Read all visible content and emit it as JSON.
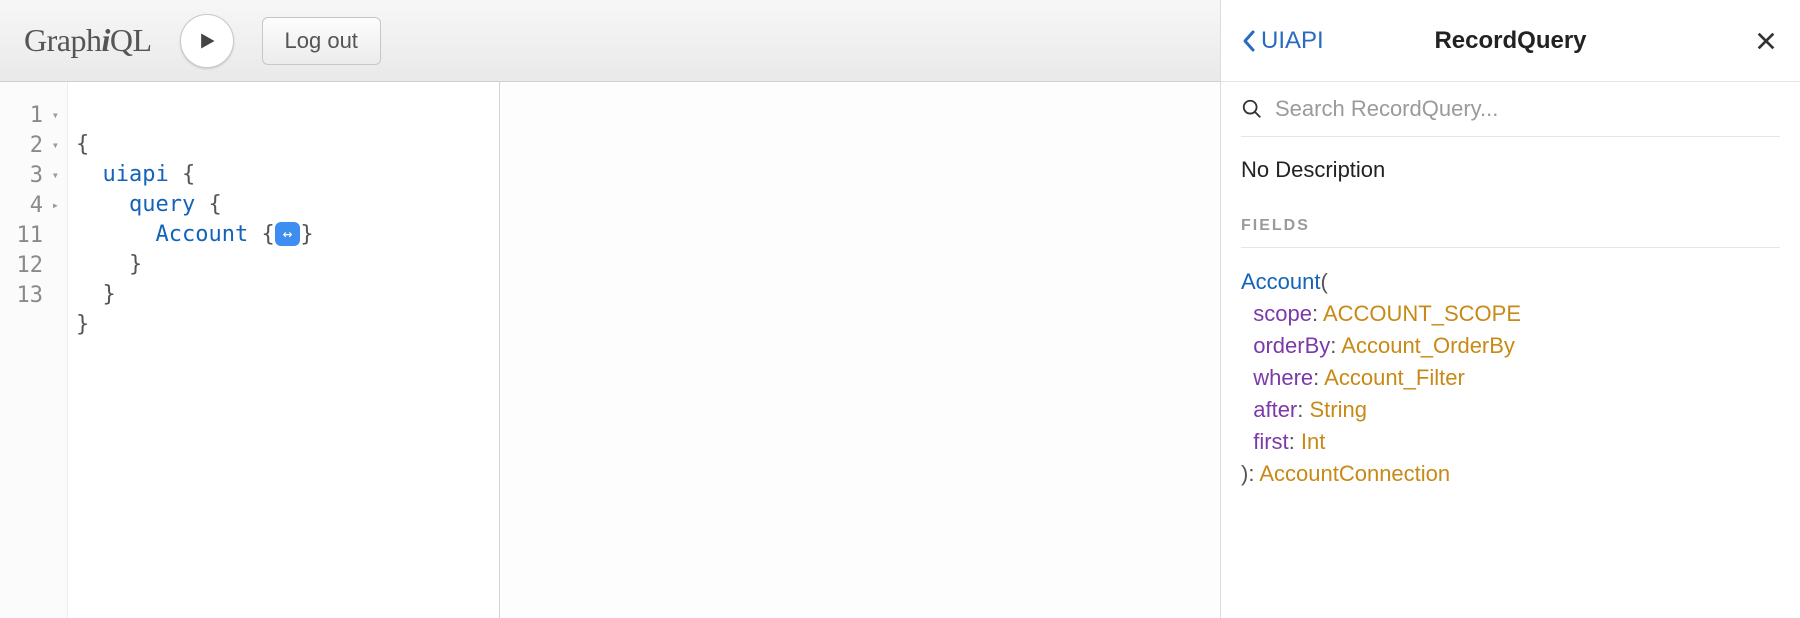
{
  "topbar": {
    "logo_prefix": "Graph",
    "logo_i": "i",
    "logo_suffix": "QL",
    "logout_label": "Log out"
  },
  "editor": {
    "lines": [
      {
        "n": "1",
        "fold": "▾"
      },
      {
        "n": "2",
        "fold": "▾"
      },
      {
        "n": "3",
        "fold": "▾"
      },
      {
        "n": "4",
        "fold": "▸"
      },
      {
        "n": "11",
        "fold": ""
      },
      {
        "n": "12",
        "fold": ""
      },
      {
        "n": "13",
        "fold": ""
      }
    ],
    "t_open": "{",
    "t_close": "}",
    "t_uiapi": "uiapi",
    "t_query": "query",
    "t_account": "Account",
    "fold_glyph": "↔"
  },
  "docs": {
    "back_label": "UIAPI",
    "title": "RecordQuery",
    "search_placeholder": "Search RecordQuery...",
    "description": "No Description",
    "section_fields": "FIELDS",
    "field": {
      "name": "Account",
      "args": [
        {
          "name": "scope",
          "type": "ACCOUNT_SCOPE"
        },
        {
          "name": "orderBy",
          "type": "Account_OrderBy"
        },
        {
          "name": "where",
          "type": "Account_Filter"
        },
        {
          "name": "after",
          "type": "String"
        },
        {
          "name": "first",
          "type": "Int"
        }
      ],
      "return_type": "AccountConnection"
    }
  }
}
